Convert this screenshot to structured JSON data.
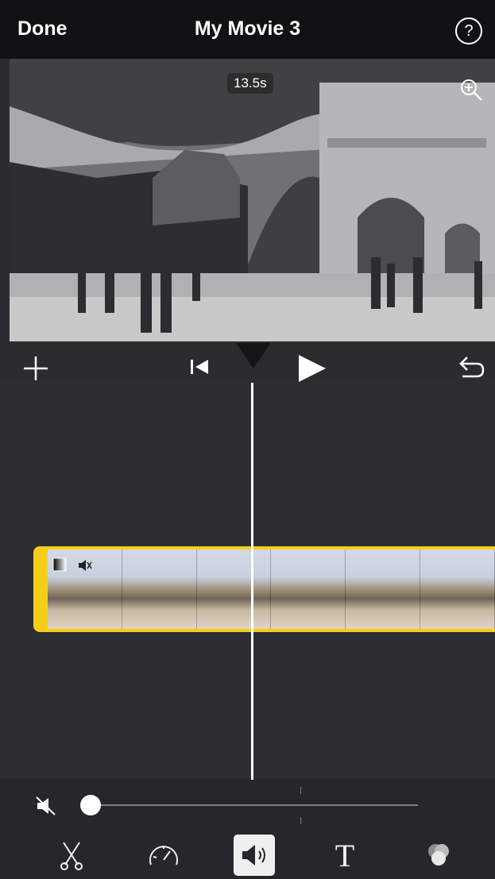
{
  "header": {
    "done_label": "Done",
    "title": "My Movie 3",
    "help_label": "?"
  },
  "preview": {
    "duration_badge": "13.5s",
    "zoom_icon": "zoom-in-icon"
  },
  "controls": {
    "add_icon": "plus-icon",
    "back_icon": "skip-to-start-icon",
    "play_icon": "play-icon",
    "undo_icon": "undo-icon"
  },
  "timeline": {
    "clip": {
      "frame_count": 6,
      "badges": [
        "fade-icon",
        "mute-icon"
      ],
      "accent": "#f5cf17"
    }
  },
  "volume": {
    "level": 0,
    "muted": true
  },
  "toolbar": {
    "items": [
      "scissors-icon",
      "speed-icon",
      "volume-icon",
      "text-icon",
      "filters-icon"
    ],
    "selected": "volume-icon",
    "text_label": "T"
  }
}
